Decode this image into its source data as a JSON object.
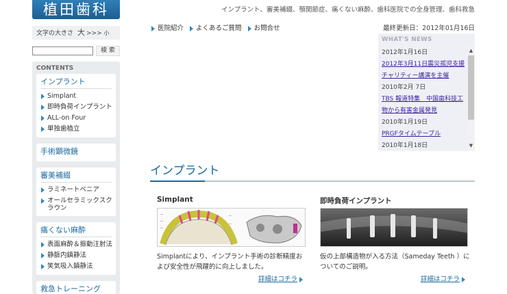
{
  "header": {
    "logo": "植田歯科",
    "tagline": "インプラント、審美補綴、顎関節症、痛くない麻酔、歯科医院での全身管理、歯科救急",
    "last_updated": "最終更新日：2012年01月16日"
  },
  "font_size": {
    "label": "文字の大きさ",
    "large": "大",
    "arrows": ">>>",
    "small": "小"
  },
  "search": {
    "placeholder": "",
    "button_label": "検 索"
  },
  "nav": {
    "links": [
      "医院紹介",
      "よくあるご質問",
      "お問合せ"
    ]
  },
  "sidebar": {
    "title": "CONTENTS",
    "sections": [
      {
        "heading": "インプラント",
        "items": [
          "Simplant",
          "即時負荷インプラント",
          "ALL-on Four",
          "単独歯植立"
        ]
      },
      {
        "heading": "手術顕微鏡",
        "items": []
      },
      {
        "heading": "審美補綴",
        "items": [
          "ラミネートベニア",
          "オールセラミックスクラウン"
        ]
      },
      {
        "heading": "痛くない麻酔",
        "items": [
          "表面麻酔＆振動注射法",
          "静脈内鎮静法",
          "笑気吸入鎮静法"
        ]
      },
      {
        "heading": "救急トレーニング",
        "items": []
      }
    ]
  },
  "news": {
    "title": "WHAT'S NEWS",
    "entries": [
      {
        "date": "2012年1月16日",
        "text": "2012年3月11日震災孤児支援チャリティー講演を主催"
      },
      {
        "date": "2010年2月 7日",
        "text": "TBS 報道特集　中国歯科技工物から有害金属発見"
      },
      {
        "date": "2010年1月19日",
        "text": "PRGFタイムテーブル"
      },
      {
        "date": "2010年1月18日",
        "text": ""
      }
    ]
  },
  "main": {
    "heading": "インプラント",
    "cards": [
      {
        "title": "Simplant",
        "text": "Simplantにより、インプラント手術の診断精度および安全性が飛躍的に向上しました。",
        "more": "詳細はコチラ"
      },
      {
        "title": "即時負荷インプラント",
        "text": "仮の上部構造物が入る方法（Sameday Teeth ）についてのご説明。",
        "more": "詳細はコチラ"
      }
    ]
  },
  "colors": {
    "accent": "#1a6aa0",
    "link": "#3a1e9b",
    "logo_bg": "#2f7fb8"
  }
}
